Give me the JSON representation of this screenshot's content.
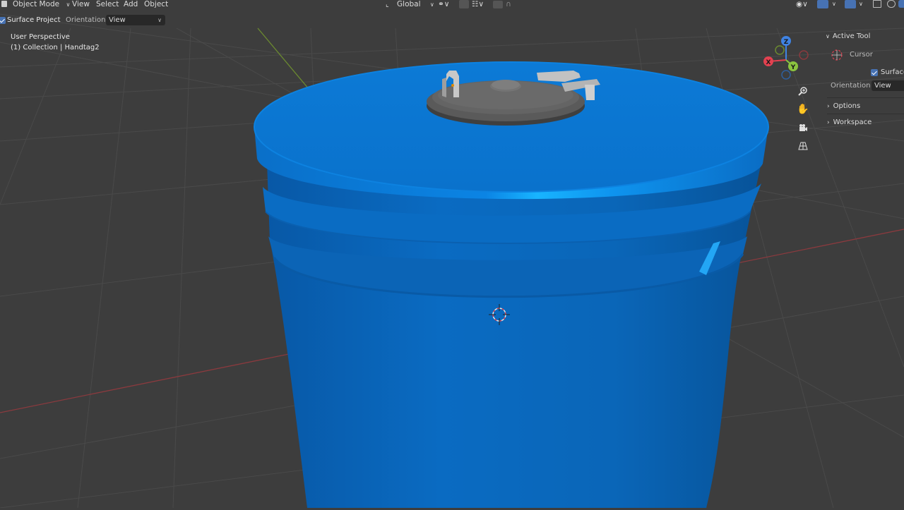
{
  "header": {
    "mode": "Object Mode",
    "menu": [
      "View",
      "Select",
      "Add",
      "Object"
    ],
    "transform_orientation": "Global"
  },
  "tool_settings": {
    "surface_project_label": "Surface Project",
    "surface_project_checked": true,
    "orientation_label": "Orientation:",
    "orientation_value": "View"
  },
  "viewport": {
    "perspective": "User Perspective",
    "collection": "(1) Collection | Handtag2",
    "gizmo_axes": [
      "Z",
      "X",
      "Y"
    ]
  },
  "sidebar": {
    "active_tool_header": "Active Tool",
    "tool_name": "Cursor",
    "surface_label": "Surface",
    "surface_checked": true,
    "orientation_label": "Orientation",
    "orientation_value": "View",
    "options_label": "Options",
    "workspace_label": "Workspace"
  },
  "colors": {
    "viewport_bg": "#3d3d3d",
    "object_blue": "#0a6fc4",
    "lid_gray": "#5a5a5a",
    "accent_checkbox": "#4772b3",
    "axis_x": "#e34150",
    "axis_y": "#8bc43f",
    "axis_z": "#3f83e3"
  },
  "icons": [
    "zoom-icon",
    "hand-pan-icon",
    "camera-icon",
    "grid-perspective-icon",
    "3d-cursor-icon"
  ]
}
